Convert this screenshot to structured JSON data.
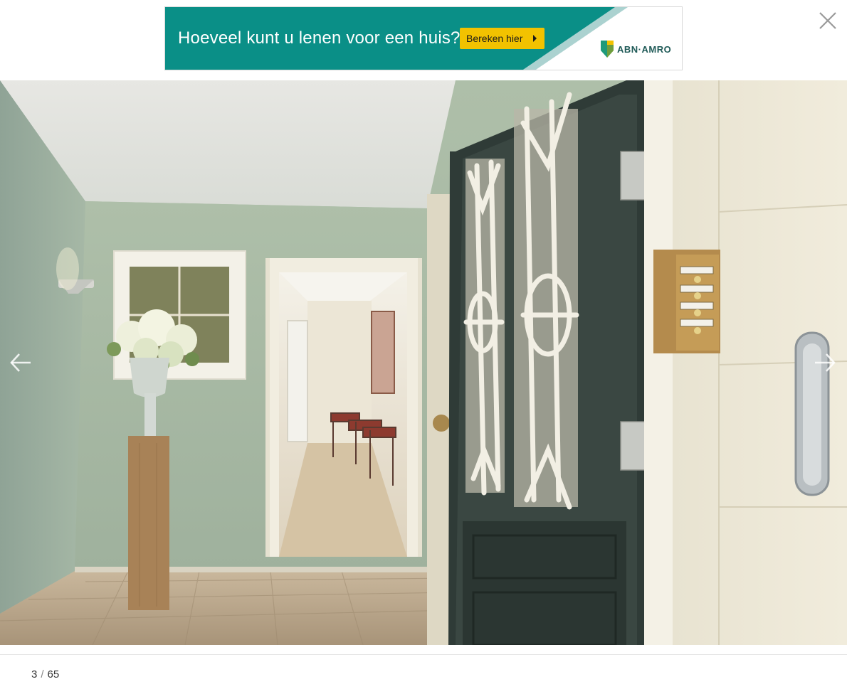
{
  "ad": {
    "headline": "Hoeveel kunt u lenen voor een huis?",
    "button_label": "Bereken hier",
    "brand": "ABN·AMRO",
    "colors": {
      "background": "#0a8f87",
      "button": "#f2c200",
      "logo_green": "#1f9a7a",
      "logo_yellow": "#f2c200"
    }
  },
  "viewer": {
    "close_icon": "close-icon",
    "prev_icon": "arrow-left-icon",
    "next_icon": "arrow-right-icon",
    "photo_subject": "photo",
    "counter": {
      "current": "3",
      "separator": "/",
      "total": "65"
    }
  }
}
